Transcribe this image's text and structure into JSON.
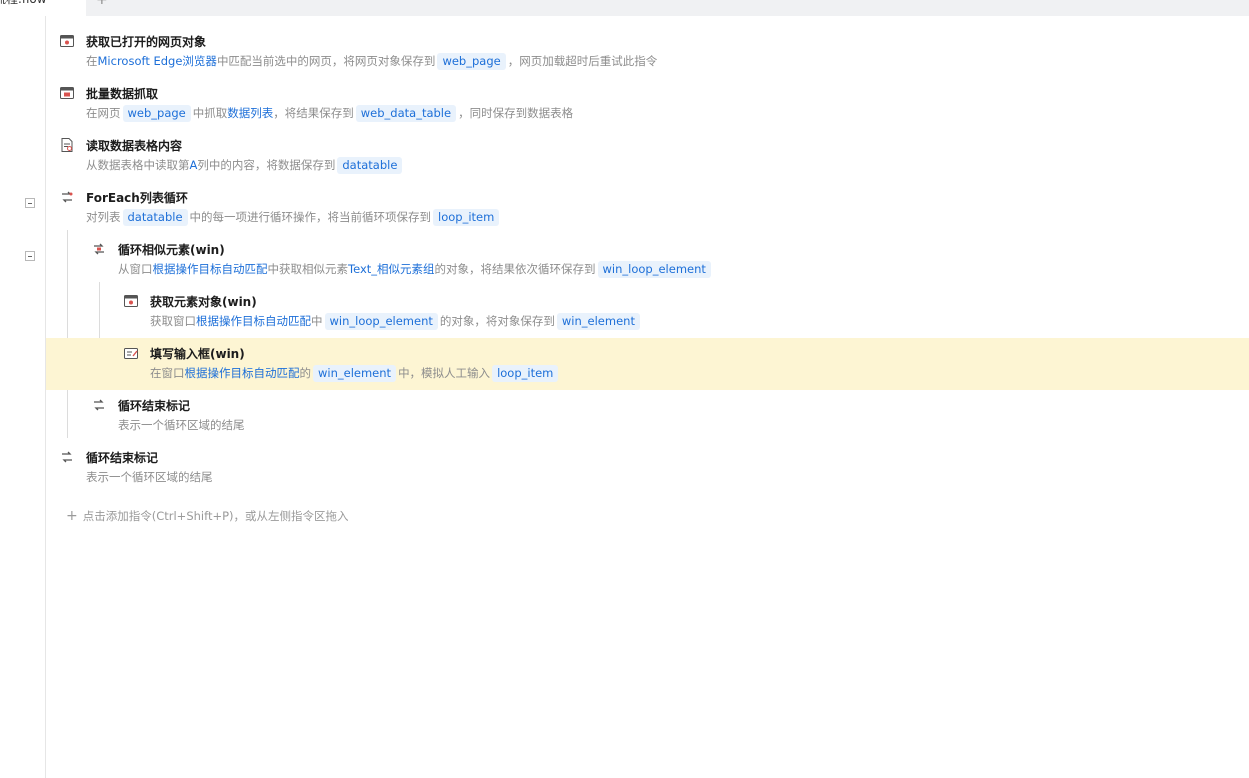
{
  "tab": {
    "title": "流程.flow",
    "add": "+"
  },
  "steps": [
    {
      "icon": "browser-window-icon",
      "title": "获取已打开的网页对象",
      "desc": [
        {
          "t": "在"
        },
        {
          "t": "Microsoft Edge浏览器",
          "k": "link"
        },
        {
          "t": "中匹配当前选中的网页，将网页对象保存到"
        },
        {
          "t": "web_page",
          "k": "chip"
        },
        {
          "t": "，网页加载超时后重试此指令"
        }
      ]
    },
    {
      "icon": "data-grab-icon",
      "title": "批量数据抓取",
      "desc": [
        {
          "t": "在网页"
        },
        {
          "t": "web_page",
          "k": "chip"
        },
        {
          "t": "中抓取"
        },
        {
          "t": "数据列表",
          "k": "link"
        },
        {
          "t": "，将结果保存到"
        },
        {
          "t": "web_data_table",
          "k": "chip"
        },
        {
          "t": "，同时保存到数据表格"
        }
      ]
    },
    {
      "icon": "read-table-icon",
      "title": "读取数据表格内容",
      "desc": [
        {
          "t": "从数据表格中读取第"
        },
        {
          "t": "A",
          "k": "link"
        },
        {
          "t": "列中的内容，将数据保存到"
        },
        {
          "t": "datatable",
          "k": "chip"
        }
      ]
    },
    {
      "icon": "loop-icon",
      "title": "ForEach列表循环",
      "desc": [
        {
          "t": "对列表"
        },
        {
          "t": "datatable",
          "k": "chip"
        },
        {
          "t": "中的每一项进行循环操作，将当前循环项保存到"
        },
        {
          "t": "loop_item",
          "k": "chip"
        }
      ]
    },
    {
      "icon": "loop-element-icon",
      "title": "循环相似元素(win)",
      "desc": [
        {
          "t": "从窗口"
        },
        {
          "t": "根据操作目标自动匹配",
          "k": "link"
        },
        {
          "t": "中获取相似元素"
        },
        {
          "t": "Text_相似元素组",
          "k": "link"
        },
        {
          "t": "的对象，将结果依次循环保存到"
        },
        {
          "t": "win_loop_element",
          "k": "chip"
        }
      ]
    },
    {
      "icon": "element-window-icon",
      "title": "获取元素对象(win)",
      "desc": [
        {
          "t": "获取窗口"
        },
        {
          "t": "根据操作目标自动匹配",
          "k": "link"
        },
        {
          "t": "中"
        },
        {
          "t": "win_loop_element",
          "k": "chip"
        },
        {
          "t": "的对象，将对象保存到"
        },
        {
          "t": "win_element",
          "k": "chip"
        }
      ]
    },
    {
      "icon": "input-box-icon",
      "title": "填写输入框(win)",
      "desc": [
        {
          "t": "在窗口"
        },
        {
          "t": "根据操作目标自动匹配",
          "k": "link"
        },
        {
          "t": "的"
        },
        {
          "t": "win_element",
          "k": "chip"
        },
        {
          "t": "中，模拟人工输入"
        },
        {
          "t": "loop_item",
          "k": "chip"
        }
      ]
    },
    {
      "icon": "loop-end-icon",
      "title": "循环结束标记",
      "desc": [
        {
          "t": "表示一个循环区域的结尾"
        }
      ]
    },
    {
      "icon": "loop-end-icon",
      "title": "循环结束标记",
      "desc": [
        {
          "t": "表示一个循环区域的结尾"
        }
      ]
    }
  ],
  "add_command": {
    "plus": "+",
    "label": "点击添加指令(Ctrl+Shift+P)，或从左侧指令区拖入"
  },
  "colors": {
    "link": "#1d6fd8",
    "chip_bg": "#e9f2fc",
    "selected_row": "#fdf5d3",
    "icon_red": "#d9534f"
  }
}
